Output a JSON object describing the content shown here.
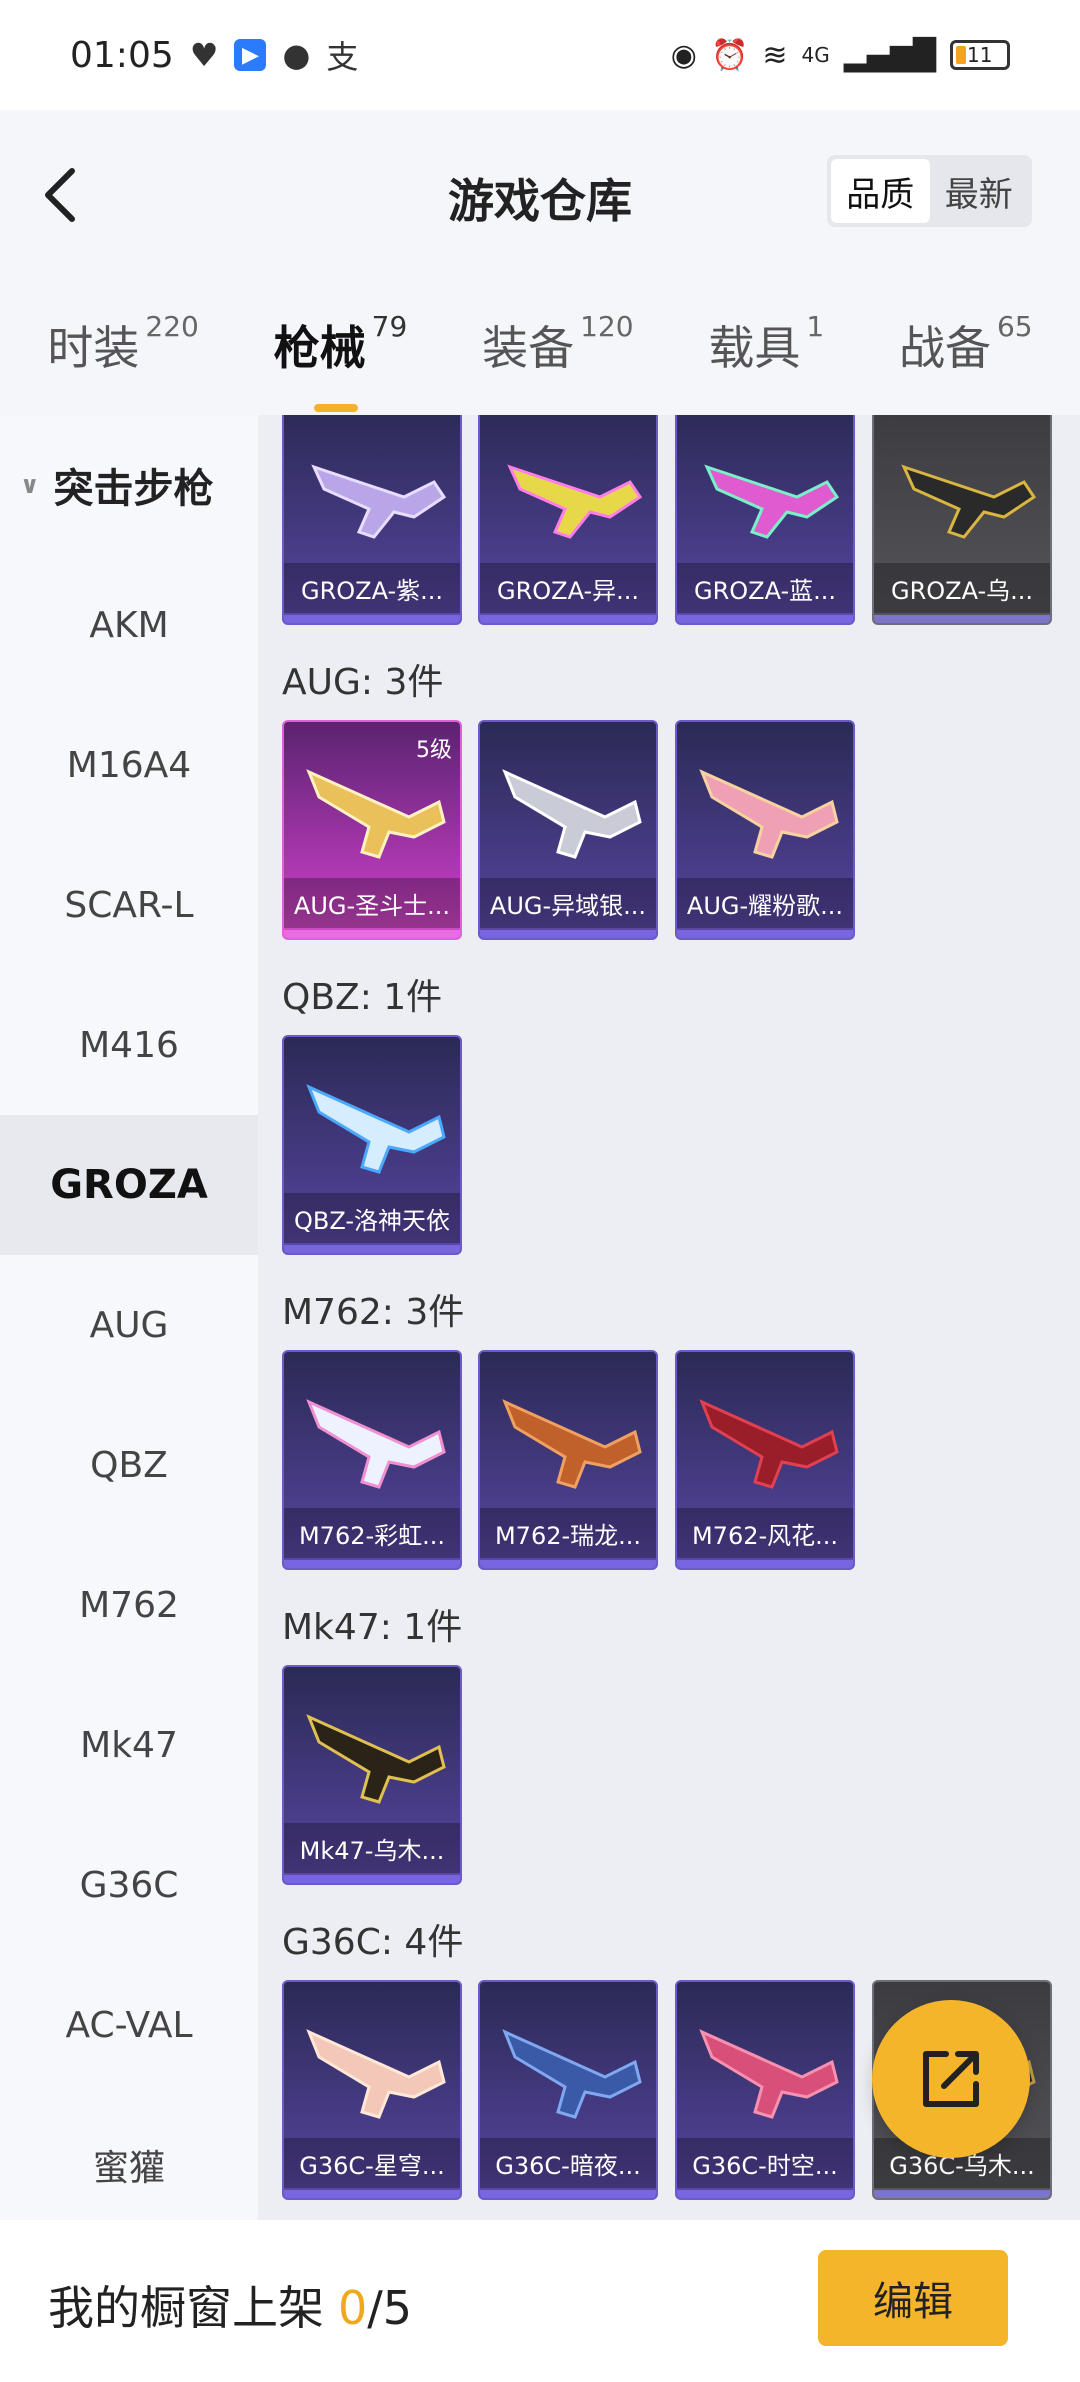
{
  "status": {
    "time": "01:05",
    "network": "4G",
    "battery": "11"
  },
  "header": {
    "title": "游戏仓库",
    "sort_options": [
      "品质",
      "最新"
    ],
    "sort_active": "品质"
  },
  "tabs": [
    {
      "label": "时装",
      "count": "220"
    },
    {
      "label": "枪械",
      "count": "79"
    },
    {
      "label": "装备",
      "count": "120"
    },
    {
      "label": "载具",
      "count": "1"
    },
    {
      "label": "战备",
      "count": "65"
    }
  ],
  "sidebar": {
    "category": "突击步枪",
    "items": [
      "AKM",
      "M16A4",
      "SCAR-L",
      "M416",
      "GROZA",
      "AUG",
      "QBZ",
      "M762",
      "Mk47",
      "G36C",
      "AC-VAL",
      "蜜獾"
    ],
    "active": "GROZA"
  },
  "groups": [
    {
      "title": "",
      "items": [
        {
          "label": "GROZA-紫...",
          "style": "purple"
        },
        {
          "label": "GROZA-异...",
          "style": "purple"
        },
        {
          "label": "GROZA-蓝...",
          "style": "purple"
        },
        {
          "label": "GROZA-乌...",
          "style": "grey"
        }
      ]
    },
    {
      "title": "AUG: 3件",
      "items": [
        {
          "label": "AUG-圣斗士...",
          "style": "legend",
          "level": "5级"
        },
        {
          "label": "AUG-异域银...",
          "style": "purple"
        },
        {
          "label": "AUG-耀粉歌...",
          "style": "purple"
        }
      ]
    },
    {
      "title": "QBZ: 1件",
      "items": [
        {
          "label": "QBZ-洛神天依",
          "style": "purple"
        }
      ]
    },
    {
      "title": "M762: 3件",
      "items": [
        {
          "label": "M762-彩虹...",
          "style": "purple"
        },
        {
          "label": "M762-瑞龙...",
          "style": "purple"
        },
        {
          "label": "M762-风花...",
          "style": "purple"
        }
      ]
    },
    {
      "title": "Mk47: 1件",
      "items": [
        {
          "label": "Mk47-乌木...",
          "style": "purple"
        }
      ]
    },
    {
      "title": "G36C: 4件",
      "items": [
        {
          "label": "G36C-星穹...",
          "style": "purple"
        },
        {
          "label": "G36C-暗夜...",
          "style": "purple"
        },
        {
          "label": "G36C-时空...",
          "style": "purple"
        },
        {
          "label": "G36C-乌木...",
          "style": "grey"
        }
      ]
    }
  ],
  "bottom": {
    "showcase_label": "我的橱窗上架",
    "showcase_count": "0",
    "showcase_sep": "/",
    "showcase_total": "5",
    "edit_label": "编辑"
  },
  "colors": {
    "accent": "#f5b52a",
    "card_purple": "#4a3d8a",
    "card_legend": "#b63ab8",
    "card_grey": "#55555b"
  },
  "icons": {
    "back": "chevron-left-icon",
    "fab": "share-external-icon",
    "tab_chevron": "chevron-down-icon"
  }
}
